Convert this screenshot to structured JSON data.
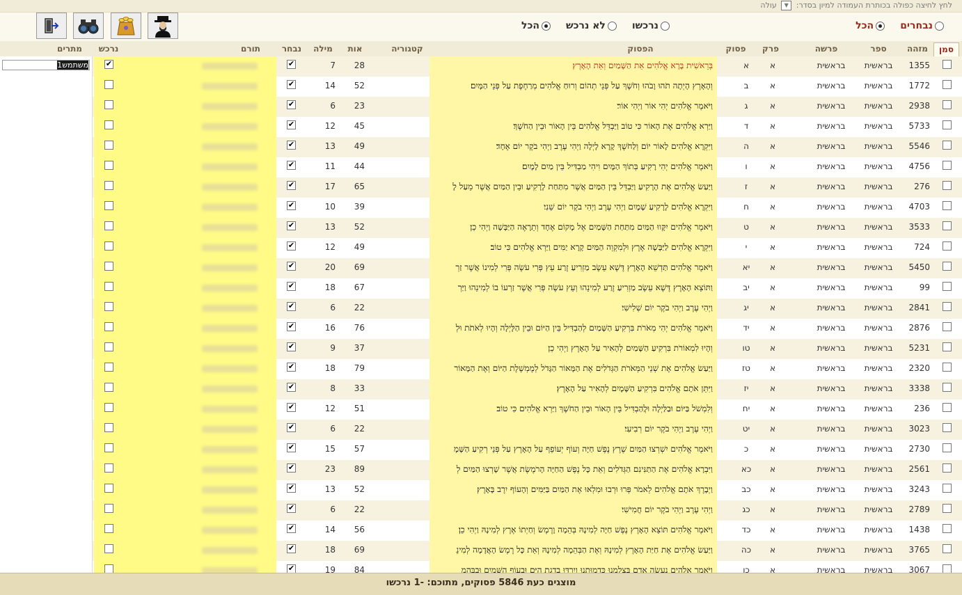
{
  "sort": {
    "hint": "לחץ לחיצה כפולה בכותרת העמודה למיון בסדר:",
    "value": "עולה"
  },
  "filters": {
    "group1": [
      {
        "label": "נבחרים",
        "checked": false,
        "color": "#9a2a1e"
      },
      {
        "label": "הכל",
        "checked": true,
        "color": "#9a2a1e"
      }
    ],
    "group2": [
      {
        "label": "נרכשו",
        "checked": false,
        "color": "#333333"
      },
      {
        "label": "לא נרכש",
        "checked": false,
        "color": "#333333"
      },
      {
        "label": "הכל",
        "checked": true,
        "color": "#333333"
      }
    ]
  },
  "toolbar": {
    "icons": [
      "rabbi-icon",
      "coins-icon",
      "binoculars-icon",
      "exit-icon"
    ]
  },
  "columns": {
    "mark": "סמן",
    "id": "מזהה",
    "book": "ספר",
    "parasha": "פרשה",
    "chapter": "פרק",
    "verse_no": "פסוק",
    "verse": "הפסוק",
    "category": "קטגוריה",
    "letters": "אות",
    "words": "מילה",
    "chosen": "נבחר",
    "donor": "תורם",
    "purchased": "נרכש",
    "donors": "מתרים"
  },
  "first_row_input": "משתמש1",
  "rows": [
    {
      "id": "1355",
      "book": "בראשית",
      "chapter": "א",
      "verse_no": "א",
      "verse": "בְּרֵאשִׁית בָּרָא אֱלֹהִים אֵת הַשָּׁמַיִם וְאֵת הָאָרֶץ׃",
      "letters": "28",
      "words": "7",
      "chosen": true,
      "purchased": true,
      "highlight": true
    },
    {
      "id": "1772",
      "book": "בראשית",
      "chapter": "א",
      "verse_no": "ב",
      "verse": "וְהָאָרֶץ הָיְתָה תֹהוּ וָבֹהוּ וְחֹשֶׁךְ עַל פְּנֵי תְהוֹם וְרוּחַ אֱלֹהִים מְרַחֶפֶת עַל פְּנֵי הַמָּיִם׃",
      "letters": "52",
      "words": "14",
      "chosen": true,
      "purchased": false
    },
    {
      "id": "2938",
      "book": "בראשית",
      "chapter": "א",
      "verse_no": "ג",
      "verse": "וַיֹּאמֶר אֱלֹהִים יְהִי אוֹר וַיְהִי אוֹר׃",
      "letters": "23",
      "words": "6",
      "chosen": true,
      "purchased": false
    },
    {
      "id": "5733",
      "book": "בראשית",
      "chapter": "א",
      "verse_no": "ד",
      "verse": "וַיַּרְא אֱלֹהִים אֶת הָאוֹר כִּי טוֹב וַיַּבְדֵּל אֱלֹהִים בֵּין הָאוֹר וּבֵין הַחֹשֶׁךְ׃",
      "letters": "45",
      "words": "12",
      "chosen": true,
      "purchased": false
    },
    {
      "id": "5546",
      "book": "בראשית",
      "chapter": "א",
      "verse_no": "ה",
      "verse": "וַיִּקְרָא אֱלֹהִים לָאוֹר יוֹם וְלַחֹשֶׁךְ קָרָא לָיְלָה וַיְהִי עֶרֶב וַיְהִי בֹקֶר יוֹם אֶחָד׃",
      "letters": "49",
      "words": "13",
      "chosen": true,
      "purchased": false
    },
    {
      "id": "4756",
      "book": "בראשית",
      "chapter": "א",
      "verse_no": "ו",
      "verse": "וַיֹּאמֶר אֱלֹהִים יְהִי רָקִיעַ בְּתוֹךְ הַמָּיִם וִיהִי מַבְדִּיל בֵּין מַיִם לָמָיִם׃",
      "letters": "44",
      "words": "11",
      "chosen": true,
      "purchased": false
    },
    {
      "id": "276",
      "book": "בראשית",
      "chapter": "א",
      "verse_no": "ז",
      "verse": "וַיַּעַשׂ אֱלֹהִים אֶת הָרָקִיעַ וַיַּבְדֵּל בֵּין הַמַּיִם אֲשֶׁר מִתַּחַת לָרָקִיעַ וּבֵין הַמַּיִם אֲשֶׁר מֵעַל לָ",
      "letters": "65",
      "words": "17",
      "chosen": true,
      "purchased": false
    },
    {
      "id": "4703",
      "book": "בראשית",
      "chapter": "א",
      "verse_no": "ח",
      "verse": "וַיִּקְרָא אֱלֹהִים לָרָקִיעַ שָׁמָיִם וַיְהִי עֶרֶב וַיְהִי בֹקֶר יוֹם שֵׁנִי׃",
      "letters": "39",
      "words": "10",
      "chosen": true,
      "purchased": false
    },
    {
      "id": "3533",
      "book": "בראשית",
      "chapter": "א",
      "verse_no": "ט",
      "verse": "וַיֹּאמֶר אֱלֹהִים יִקָּווּ הַמַּיִם מִתַּחַת הַשָּׁמַיִם אֶל מָקוֹם אֶחָד וְתֵרָאֶה הַיַּבָּשָׁה וַיְהִי כֵן׃",
      "letters": "52",
      "words": "13",
      "chosen": true,
      "purchased": false
    },
    {
      "id": "724",
      "book": "בראשית",
      "chapter": "א",
      "verse_no": "י",
      "verse": "וַיִּקְרָא אֱלֹהִים לַיַּבָּשָׁה אֶרֶץ וּלְמִקְוֵה הַמַּיִם קָרָא יַמִּים וַיַּרְא אֱלֹהִים כִּי טוֹב׃",
      "letters": "49",
      "words": "12",
      "chosen": true,
      "purchased": false
    },
    {
      "id": "5450",
      "book": "בראשית",
      "chapter": "א",
      "verse_no": "יא",
      "verse": "וַיֹּאמֶר אֱלֹהִים תַּדְשֵׁא הָאָרֶץ דֶּשֶׁא עֵשֶׂב מַזְרִיעַ זֶרַע עֵץ פְּרִי עֹשֶׂה פְּרִי לְמִינוֹ אֲשֶׁר זַרְ",
      "letters": "69",
      "words": "20",
      "chosen": true,
      "purchased": false
    },
    {
      "id": "99",
      "book": "בראשית",
      "chapter": "א",
      "verse_no": "יב",
      "verse": "וַתּוֹצֵא הָאָרֶץ דֶּשֶׁא עֵשֶׂב מַזְרִיעַ זֶרַע לְמִינֵהוּ וְעֵץ עֹשֶׂה פְּרִי אֲשֶׁר זַרְעוֹ בוֹ לְמִינֵהוּ וַיַּרְ",
      "letters": "67",
      "words": "18",
      "chosen": true,
      "purchased": false
    },
    {
      "id": "2841",
      "book": "בראשית",
      "chapter": "א",
      "verse_no": "יג",
      "verse": "וַיְהִי עֶרֶב וַיְהִי בֹקֶר יוֹם שְׁלִישִׁי׃",
      "letters": "22",
      "words": "6",
      "chosen": true,
      "purchased": false
    },
    {
      "id": "2876",
      "book": "בראשית",
      "chapter": "א",
      "verse_no": "יד",
      "verse": "וַיֹּאמֶר אֱלֹהִים יְהִי מְאֹרֹת בִּרְקִיעַ הַשָּׁמַיִם לְהַבְדִּיל בֵּין הַיּוֹם וּבֵין הַלָּיְלָה וְהָיוּ לְאֹתֹת וּלְ",
      "letters": "76",
      "words": "16",
      "chosen": true,
      "purchased": false
    },
    {
      "id": "5231",
      "book": "בראשית",
      "chapter": "א",
      "verse_no": "טו",
      "verse": "וְהָיוּ לִמְאוֹרֹת בִּרְקִיעַ הַשָּׁמַיִם לְהָאִיר עַל הָאָרֶץ וַיְהִי כֵן׃",
      "letters": "37",
      "words": "9",
      "chosen": true,
      "purchased": false
    },
    {
      "id": "2320",
      "book": "בראשית",
      "chapter": "א",
      "verse_no": "טז",
      "verse": "וַיַּעַשׂ אֱלֹהִים אֶת שְׁנֵי הַמְּאֹרֹת הַגְּדֹלִים אֶת הַמָּאוֹר הַגָּדֹל לְמֶמְשֶׁלֶת הַיּוֹם וְאֶת הַמָּאוֹר",
      "letters": "79",
      "words": "18",
      "chosen": true,
      "purchased": false
    },
    {
      "id": "3338",
      "book": "בראשית",
      "chapter": "א",
      "verse_no": "יז",
      "verse": "וַיִּתֵּן אֹתָם אֱלֹהִים בִּרְקִיעַ הַשָּׁמָיִם לְהָאִיר עַל הָאָרֶץ׃",
      "letters": "33",
      "words": "8",
      "chosen": true,
      "purchased": false
    },
    {
      "id": "236",
      "book": "בראשית",
      "chapter": "א",
      "verse_no": "יח",
      "verse": "וְלִמְשֹׁל בַּיּוֹם וּבַלַּיְלָה וּלֲהַבְדִּיל בֵּין הָאוֹר וּבֵין הַחֹשֶׁךְ וַיַּרְא אֱלֹהִים כִּי טוֹב׃",
      "letters": "51",
      "words": "12",
      "chosen": true,
      "purchased": false
    },
    {
      "id": "3023",
      "book": "בראשית",
      "chapter": "א",
      "verse_no": "יט",
      "verse": "וַיְהִי עֶרֶב וַיְהִי בֹקֶר יוֹם רְבִיעִי׃",
      "letters": "22",
      "words": "6",
      "chosen": true,
      "purchased": false
    },
    {
      "id": "2730",
      "book": "בראשית",
      "chapter": "א",
      "verse_no": "כ",
      "verse": "וַיֹּאמֶר אֱלֹהִים יִשְׁרְצוּ הַמַּיִם שֶׁרֶץ נֶפֶשׁ חַיָּה וְעוֹף יְעוֹפֵף עַל הָאָרֶץ עַל פְּנֵי רְקִיעַ הַשָּׁמָ",
      "letters": "57",
      "words": "15",
      "chosen": true,
      "purchased": false
    },
    {
      "id": "2561",
      "book": "בראשית",
      "chapter": "א",
      "verse_no": "כא",
      "verse": "וַיִּבְרָא אֱלֹהִים אֶת הַתַּנִּינִם הַגְּדֹלִים וְאֵת כָּל נֶפֶשׁ הַחַיָּה הָרֹמֶשֶׂת אֲשֶׁר שָׁרְצוּ הַמַּיִם לְ",
      "letters": "89",
      "words": "23",
      "chosen": true,
      "purchased": false
    },
    {
      "id": "3243",
      "book": "בראשית",
      "chapter": "א",
      "verse_no": "כב",
      "verse": "וַיְבָרֶךְ אֹתָם אֱלֹהִים לֵאמֹר פְּרוּ וּרְבוּ וּמִלְאוּ אֶת הַמַּיִם בַּיַּמִּים וְהָעוֹף יִרֶב בָּאָרֶץ׃",
      "letters": "52",
      "words": "13",
      "chosen": true,
      "purchased": false
    },
    {
      "id": "2789",
      "book": "בראשית",
      "chapter": "א",
      "verse_no": "כג",
      "verse": "וַיְהִי עֶרֶב וַיְהִי בֹקֶר יוֹם חֲמִישִׁי׃",
      "letters": "22",
      "words": "6",
      "chosen": true,
      "purchased": false
    },
    {
      "id": "1438",
      "book": "בראשית",
      "chapter": "א",
      "verse_no": "כד",
      "verse": "וַיֹּאמֶר אֱלֹהִים תּוֹצֵא הָאָרֶץ נֶפֶשׁ חַיָּה לְמִינָהּ בְּהֵמָה וָרֶמֶשׂ וְחַיְתוֹ אֶרֶץ לְמִינָהּ וַיְהִי כֵן׃",
      "letters": "56",
      "words": "14",
      "chosen": true,
      "purchased": false
    },
    {
      "id": "3765",
      "book": "בראשית",
      "chapter": "א",
      "verse_no": "כה",
      "verse": "וַיַּעַשׂ אֱלֹהִים אֶת חַיַּת הָאָרֶץ לְמִינָהּ וְאֶת הַבְּהֵמָה לְמִינָהּ וְאֵת כָּל רֶמֶשׂ הָאֲדָמָה לְמִינֵ",
      "letters": "69",
      "words": "18",
      "chosen": true,
      "purchased": false
    },
    {
      "id": "3067",
      "book": "בראשית",
      "chapter": "א",
      "verse_no": "כו",
      "verse": "וַיֹּאמֶר אֱלֹהִים נַעֲשֶׂה אָדָם בְּצַלְמֵנוּ כִּדְמוּתֵנוּ וְיִרְדּוּ בִדְגַת הַיָּם וּבְעוֹף הַשָּׁמַיִם וּבַבְּהֵמ",
      "letters": "84",
      "words": "19",
      "chosen": true,
      "purchased": false
    }
  ],
  "footer": "מוצגים כעת 5846 פסוקים, מתוכם: -1 נרכשו"
}
